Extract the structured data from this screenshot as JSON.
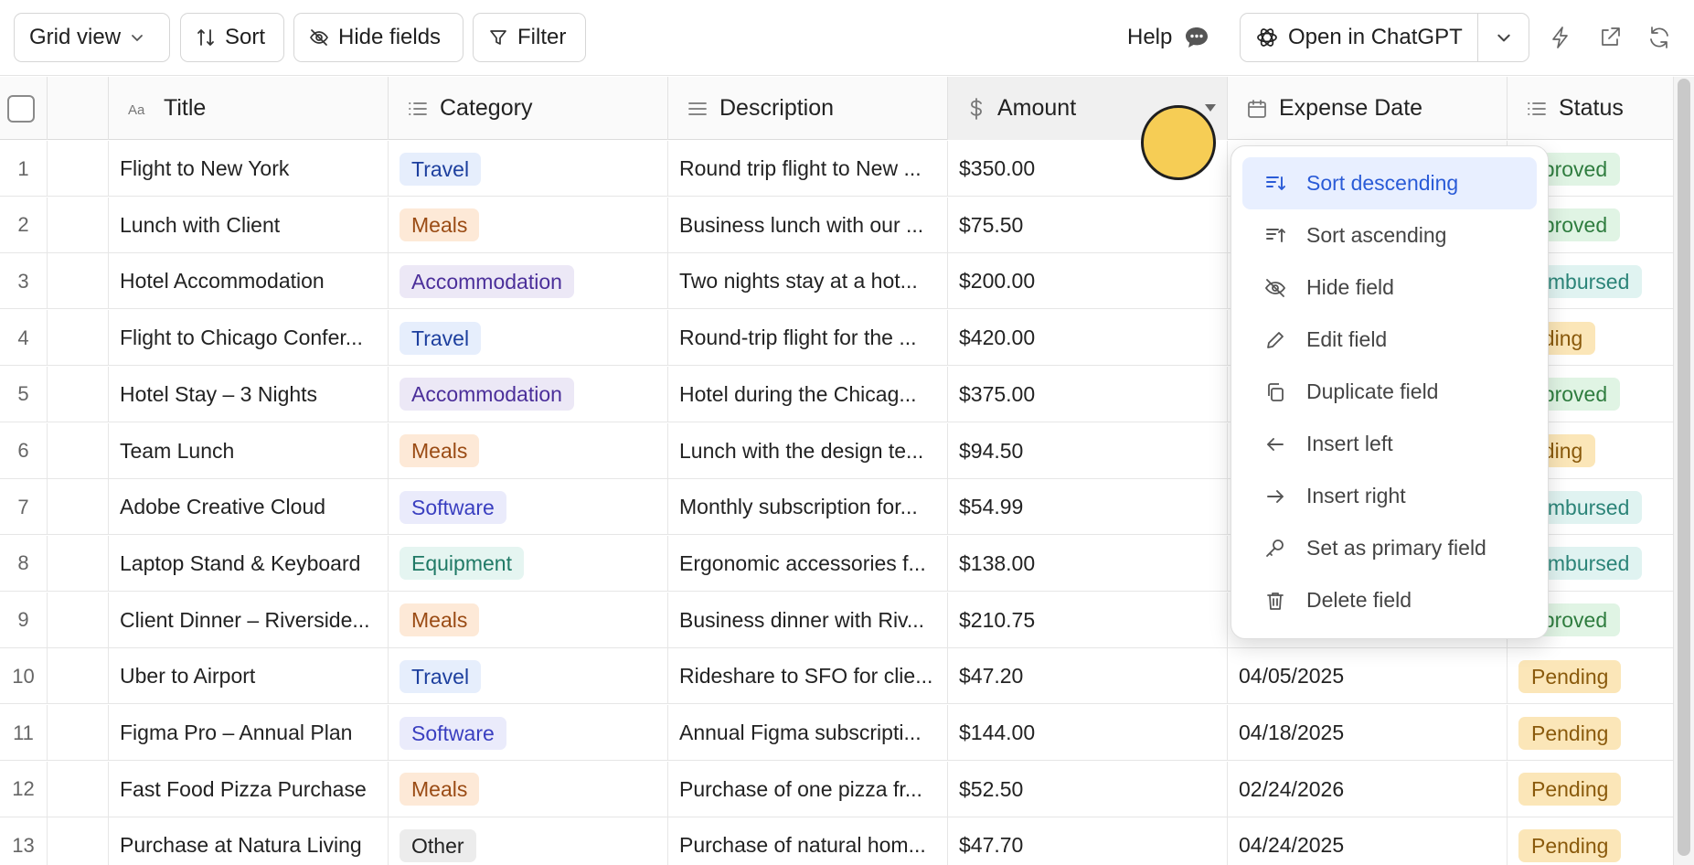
{
  "toolbar": {
    "grid_view": "Grid view",
    "sort": "Sort",
    "hide_fields": "Hide fields",
    "filter": "Filter",
    "help": "Help",
    "open_chatgpt": "Open in ChatGPT"
  },
  "columns": {
    "title": "Title",
    "category": "Category",
    "description": "Description",
    "amount": "Amount",
    "expense_date": "Expense Date",
    "status": "Status"
  },
  "rows": [
    {
      "num": "1",
      "title": "Flight to New York",
      "category": "Travel",
      "description": "Round trip flight to New ...",
      "amount": "$350.00",
      "date": "",
      "status": "pproved"
    },
    {
      "num": "2",
      "title": "Lunch with Client",
      "category": "Meals",
      "description": "Business lunch with our ...",
      "amount": "$75.50",
      "date": "",
      "status": "pproved"
    },
    {
      "num": "3",
      "title": "Hotel Accommodation",
      "category": "Accommodation",
      "description": "Two nights stay at a hot...",
      "amount": "$200.00",
      "date": "",
      "status": "eimbursed"
    },
    {
      "num": "4",
      "title": "Flight to Chicago Confer...",
      "category": "Travel",
      "description": "Round-trip flight for the ...",
      "amount": "$420.00",
      "date": "",
      "status": "nding"
    },
    {
      "num": "5",
      "title": "Hotel Stay – 3 Nights",
      "category": "Accommodation",
      "description": "Hotel during the Chicag...",
      "amount": "$375.00",
      "date": "",
      "status": "pproved"
    },
    {
      "num": "6",
      "title": "Team Lunch",
      "category": "Meals",
      "description": "Lunch with the design te...",
      "amount": "$94.50",
      "date": "",
      "status": "nding"
    },
    {
      "num": "7",
      "title": "Adobe Creative Cloud",
      "category": "Software",
      "description": "Monthly subscription for...",
      "amount": "$54.99",
      "date": "",
      "status": "eimbursed"
    },
    {
      "num": "8",
      "title": "Laptop Stand & Keyboard",
      "category": "Equipment",
      "description": "Ergonomic accessories f...",
      "amount": "$138.00",
      "date": "",
      "status": "eimbursed"
    },
    {
      "num": "9",
      "title": "Client Dinner – Riverside...",
      "category": "Meals",
      "description": "Business dinner with Riv...",
      "amount": "$210.75",
      "date": "",
      "status": "pproved"
    },
    {
      "num": "10",
      "title": "Uber to Airport",
      "category": "Travel",
      "description": "Rideshare to SFO for clie...",
      "amount": "$47.20",
      "date": "04/05/2025",
      "status": "Pending"
    },
    {
      "num": "11",
      "title": "Figma Pro – Annual Plan",
      "category": "Software",
      "description": "Annual Figma subscripti...",
      "amount": "$144.00",
      "date": "04/18/2025",
      "status": "Pending"
    },
    {
      "num": "12",
      "title": "Fast Food Pizza Purchase",
      "category": "Meals",
      "description": "Purchase of one pizza fr...",
      "amount": "$52.50",
      "date": "02/24/2026",
      "status": "Pending"
    },
    {
      "num": "13",
      "title": "Purchase at Natura Living",
      "category": "Other",
      "description": "Purchase of natural hom...",
      "amount": "$47.70",
      "date": "04/24/2025",
      "status": "Pending"
    }
  ],
  "category_colors": {
    "Travel": {
      "bg": "#e6eefc",
      "fg": "#1d3f9e"
    },
    "Meals": {
      "bg": "#fde9d7",
      "fg": "#9a4b14"
    },
    "Accommodation": {
      "bg": "#ece8f6",
      "fg": "#4b2f9a"
    },
    "Software": {
      "bg": "#eaebfb",
      "fg": "#3a3fc0"
    },
    "Equipment": {
      "bg": "#e5f5f1",
      "fg": "#207a66"
    },
    "Other": {
      "bg": "#ececec",
      "fg": "#222222"
    }
  },
  "status_colors": {
    "pproved": {
      "bg": "#e0f4e4",
      "fg": "#2f7d3f"
    },
    "eimbursed": {
      "bg": "#e0f3f1",
      "fg": "#2b8478"
    },
    "nding": {
      "bg": "#fbe6b8",
      "fg": "#8a5a0c"
    },
    "Pending": {
      "bg": "#fbe6b8",
      "fg": "#8a5a0c"
    }
  },
  "context_menu": {
    "items": [
      {
        "label": "Sort descending",
        "icon": "sort-descending-icon"
      },
      {
        "label": "Sort ascending",
        "icon": "sort-ascending-icon"
      },
      {
        "label": "Hide field",
        "icon": "eye-off-icon"
      },
      {
        "label": "Edit field",
        "icon": "pencil-icon"
      },
      {
        "label": "Duplicate field",
        "icon": "copy-icon"
      },
      {
        "label": "Insert left",
        "icon": "arrow-left-icon"
      },
      {
        "label": "Insert right",
        "icon": "arrow-right-icon"
      },
      {
        "label": "Set as primary field",
        "icon": "key-icon"
      },
      {
        "label": "Delete field",
        "icon": "trash-icon"
      }
    ]
  }
}
